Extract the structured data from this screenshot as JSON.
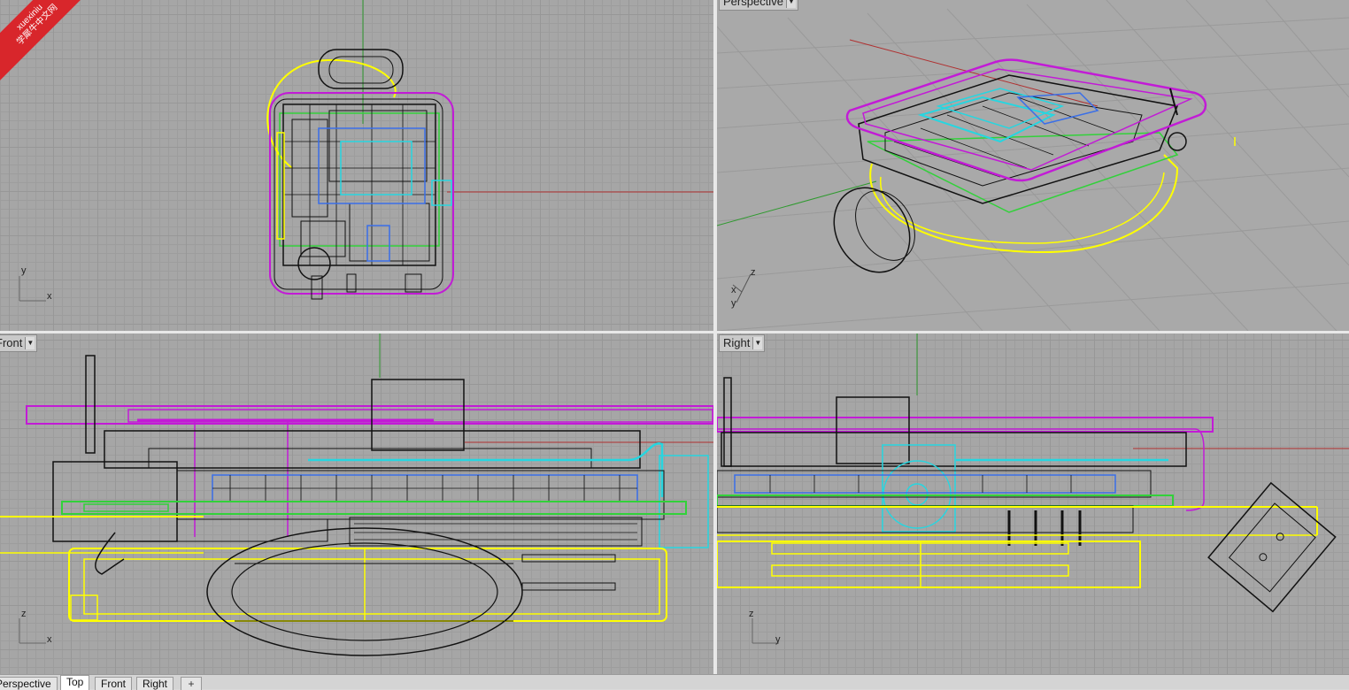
{
  "viewports": {
    "top": {
      "title": "",
      "axis_x": "x",
      "axis_y": "y"
    },
    "perspective": {
      "title": "Perspective",
      "axis_x": "x",
      "axis_y": "y",
      "axis_z": "z"
    },
    "front": {
      "title": "Front",
      "axis_x": "x",
      "axis_z": "z"
    },
    "right": {
      "title": "Right",
      "axis_y": "y",
      "axis_z": "z"
    }
  },
  "tabs": [
    {
      "label": "Perspective"
    },
    {
      "label": "Top"
    },
    {
      "label": "Front"
    },
    {
      "label": "Right"
    }
  ],
  "active_tab": "Top",
  "add_tab_symbol": "+",
  "watermark": {
    "line1": "xuexiniu",
    "line2": "学犀牛中文网"
  },
  "colors": {
    "magenta": "#c21bd6",
    "yellow": "#ffff00",
    "cyan": "#26d6e0",
    "blue": "#3a6fe8",
    "green": "#32d13a",
    "x_axis": "#b03030",
    "y_axis": "#2f9a2f"
  }
}
